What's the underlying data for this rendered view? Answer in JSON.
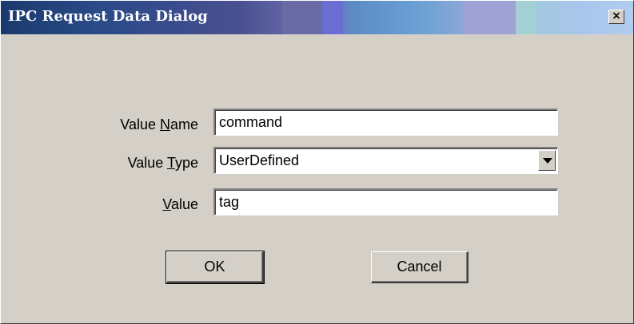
{
  "window": {
    "title": "IPC Request Data Dialog",
    "close_glyph": "×"
  },
  "form": {
    "value_name": {
      "label_prefix": "Value ",
      "label_accel": "N",
      "label_suffix": "ame",
      "value": "command"
    },
    "value_type": {
      "label_prefix": "Value ",
      "label_accel": "T",
      "label_suffix": "ype",
      "value": "UserDefined",
      "icon": "chevron-down-icon"
    },
    "value": {
      "label_prefix": "",
      "label_accel": "V",
      "label_suffix": "alue",
      "value": "tag"
    }
  },
  "buttons": {
    "ok_label": "OK",
    "cancel_label": "Cancel"
  },
  "colors": {
    "dialog_face": "#d4d0c8",
    "titlebar_start": "#1a3a6e",
    "titlebar_end": "#b0cdee",
    "title_text": "#ffffff"
  }
}
